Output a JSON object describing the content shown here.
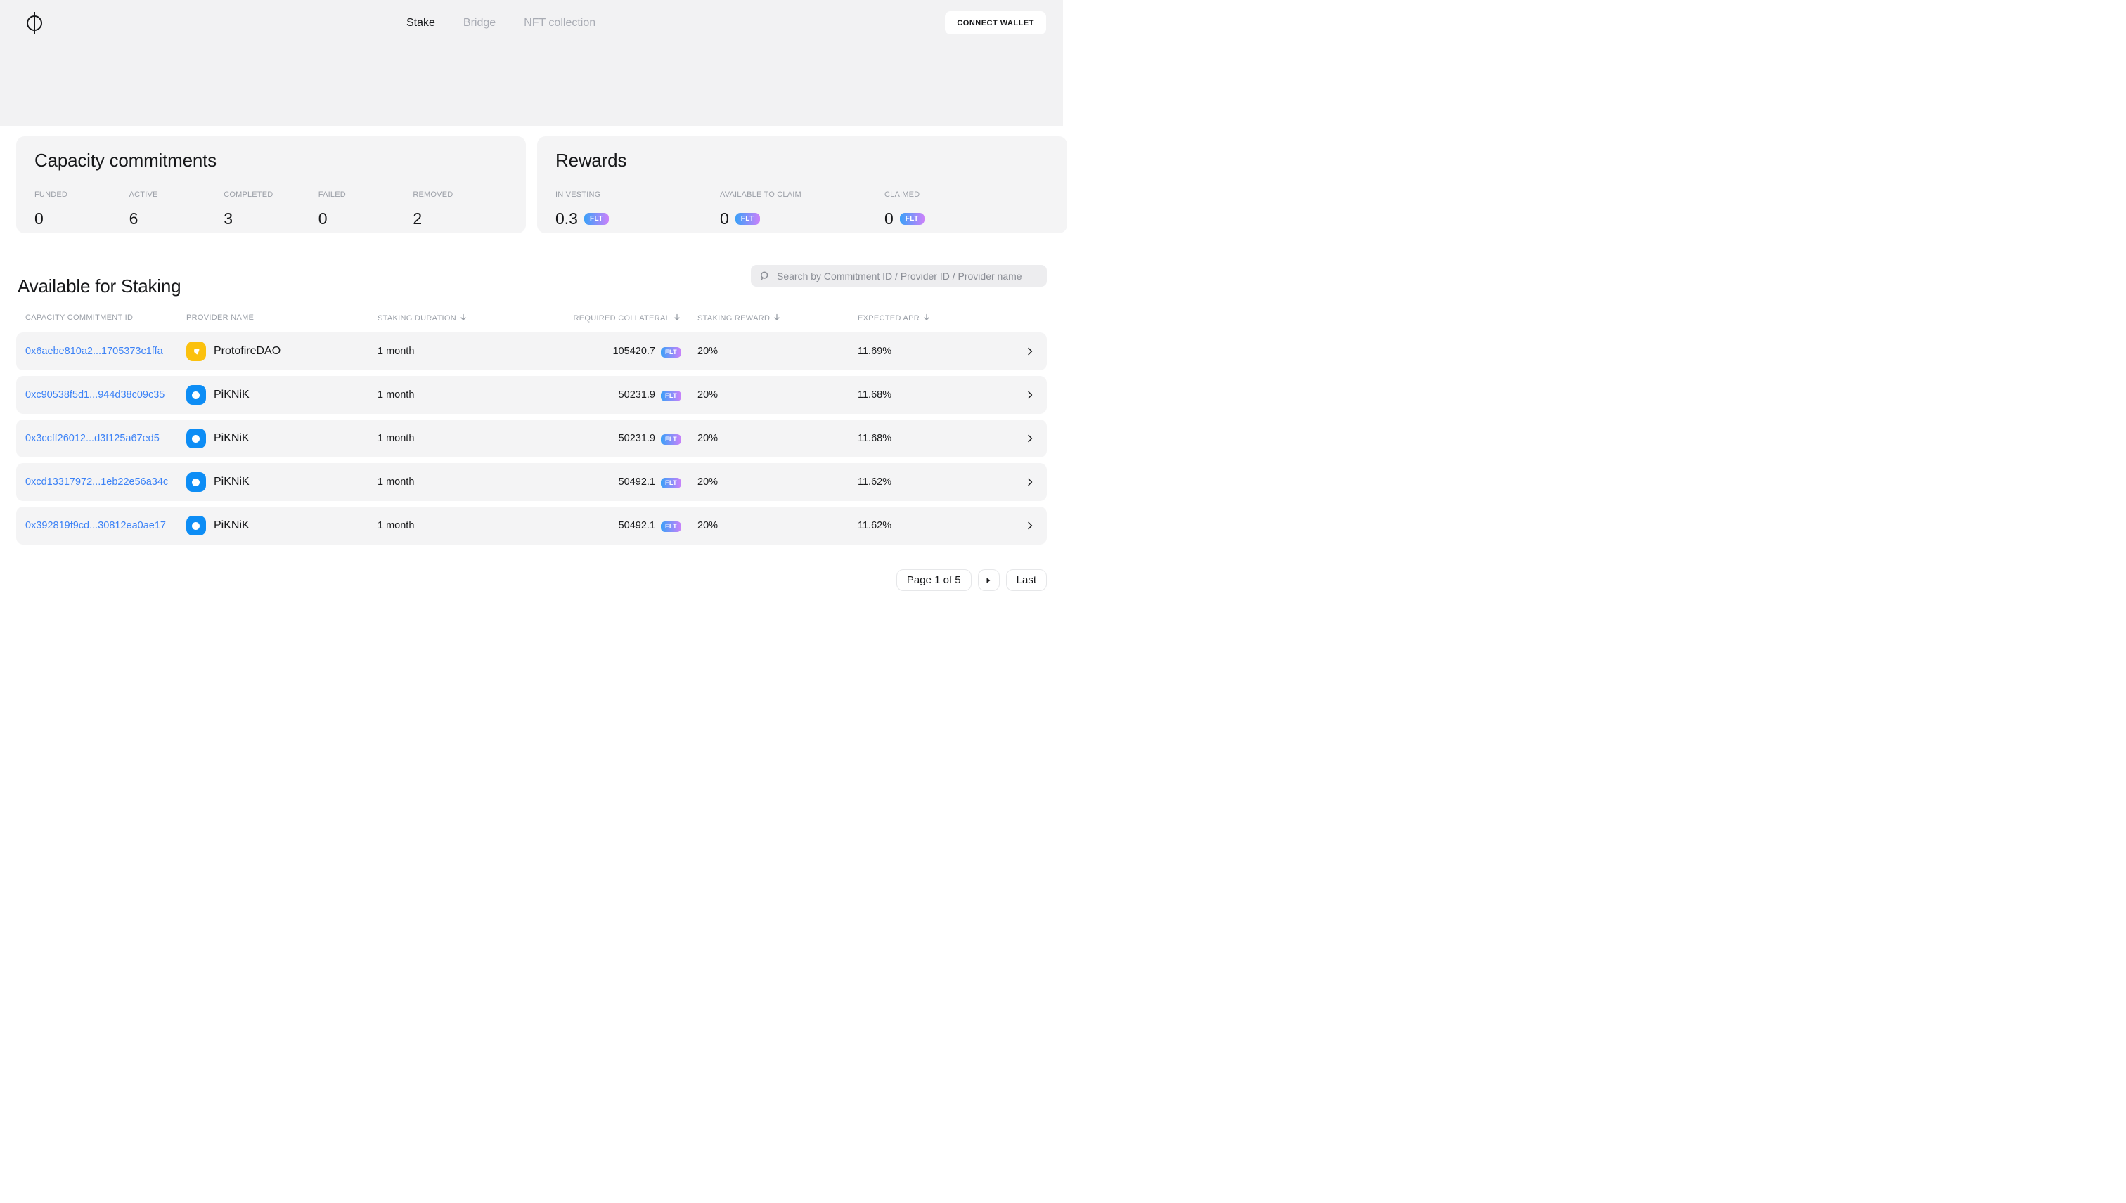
{
  "nav": {
    "logo": "fluence-phi",
    "tabs": [
      {
        "label": "Stake",
        "active": true
      },
      {
        "label": "Bridge",
        "active": false
      },
      {
        "label": "NFT collection",
        "active": false
      }
    ],
    "connect_wallet_label": "CONNECT WALLET"
  },
  "capacity_commitments": {
    "title": "Capacity commitments",
    "stats": [
      {
        "label": "FUNDED",
        "value": "0"
      },
      {
        "label": "ACTIVE",
        "value": "6"
      },
      {
        "label": "COMPLETED",
        "value": "3"
      },
      {
        "label": "FAILED",
        "value": "0"
      },
      {
        "label": "REMOVED",
        "value": "2"
      }
    ]
  },
  "rewards": {
    "title": "Rewards",
    "stats": [
      {
        "label": "IN VESTING",
        "value": "0.3",
        "unit": "FLT"
      },
      {
        "label": "AVAILABLE TO CLAIM",
        "value": "0",
        "unit": "FLT"
      },
      {
        "label": "CLAIMED",
        "value": "0",
        "unit": "FLT"
      }
    ]
  },
  "staking": {
    "title": "Available for Staking",
    "search_placeholder": "Search by Commitment ID / Provider ID / Provider name",
    "columns": [
      {
        "label": "CAPACITY COMMITMENT ID",
        "sortable": false
      },
      {
        "label": "PROVIDER NAME",
        "sortable": false
      },
      {
        "label": "STAKING DURATION",
        "sortable": true
      },
      {
        "label": "REQUIRED COLLATERAL",
        "sortable": true
      },
      {
        "label": "STAKING REWARD",
        "sortable": true
      },
      {
        "label": "EXPECTED APR",
        "sortable": true
      }
    ],
    "rows": [
      {
        "id": "0x6aebe810a2...1705373c1ffa",
        "provider": "ProtofireDAO",
        "avatar": "protofire",
        "duration": "1 month",
        "collateral": "105420.7",
        "unit": "FLT",
        "reward": "20%",
        "apr": "11.69%"
      },
      {
        "id": "0xc90538f5d1...944d38c09c35",
        "provider": "PiKNiK",
        "avatar": "piknik",
        "duration": "1 month",
        "collateral": "50231.9",
        "unit": "FLT",
        "reward": "20%",
        "apr": "11.68%"
      },
      {
        "id": "0x3ccff26012...d3f125a67ed5",
        "provider": "PiKNiK",
        "avatar": "piknik",
        "duration": "1 month",
        "collateral": "50231.9",
        "unit": "FLT",
        "reward": "20%",
        "apr": "11.68%"
      },
      {
        "id": "0xcd13317972...1eb22e56a34c",
        "provider": "PiKNiK",
        "avatar": "piknik",
        "duration": "1 month",
        "collateral": "50492.1",
        "unit": "FLT",
        "reward": "20%",
        "apr": "11.62%"
      },
      {
        "id": "0x392819f9cd...30812ea0ae17",
        "provider": "PiKNiK",
        "avatar": "piknik",
        "duration": "1 month",
        "collateral": "50492.1",
        "unit": "FLT",
        "reward": "20%",
        "apr": "11.62%"
      }
    ]
  },
  "pagination": {
    "page_label": "Page 1 of 5",
    "last_label": "Last"
  },
  "colors": {
    "top_band": "#f2f2f3",
    "card_background": "#f4f4f5",
    "link_blue": "#3c82f6",
    "flt_gradient_start": "#3aa0f8",
    "flt_gradient_end": "#cc81fa",
    "piknik_avatar_blue": "#0d8df5",
    "protofire_avatar_yellow": "#fbc10e",
    "muted_label": "#9b9fa7"
  }
}
